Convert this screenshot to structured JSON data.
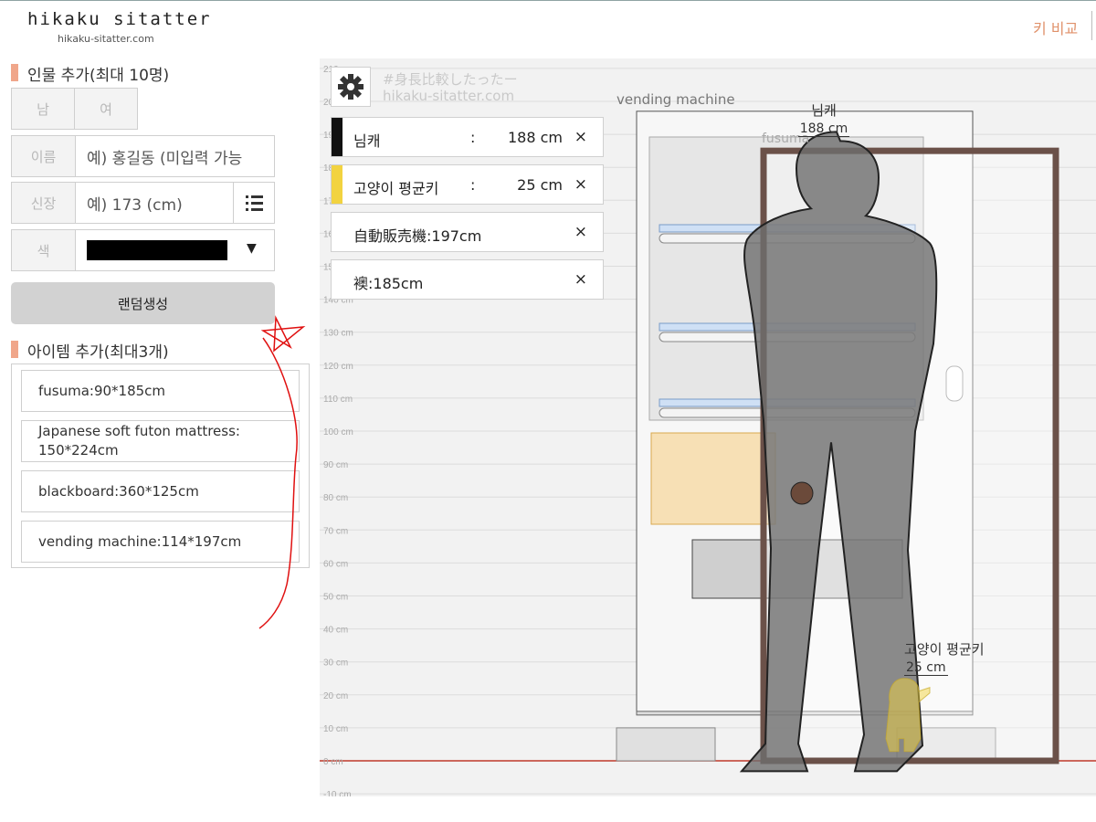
{
  "header": {
    "logo": "hikaku sitatter",
    "logo_sub": "hikaku-sitatter.com",
    "nav_compare": "키 비교"
  },
  "person_form": {
    "section_title": "인물 추가(최대 10명)",
    "gender_male": "남",
    "gender_female": "여",
    "name_label": "이름",
    "name_placeholder": "예) 홍길동 (미입력 가능",
    "height_label": "신장",
    "height_placeholder": "예) 173 (cm)",
    "color_label": "색",
    "color_value": "#000000",
    "random_button": "랜덤생성"
  },
  "items_form": {
    "section_title": "아이템 추가(최대3개)",
    "items": [
      {
        "label": "fusuma:90*185cm"
      },
      {
        "label": "Japanese soft futon mattress: 150*224cm"
      },
      {
        "label": "blackboard:360*125cm"
      },
      {
        "label": "vending machine:114*197cm"
      }
    ]
  },
  "chart": {
    "watermark_tag": "#身長比較したったー",
    "watermark_url": "hikaku-sitatter.com",
    "axis_unit": "cm",
    "axis_ticks": [
      -10,
      0,
      10,
      20,
      30,
      40,
      50,
      60,
      70,
      80,
      90,
      100,
      110,
      120,
      130,
      140,
      150,
      160,
      170,
      180,
      190,
      200,
      210
    ],
    "entries": [
      {
        "name": "님캐",
        "colon": ":",
        "value": "188 cm",
        "color": "#111111",
        "remove": "×"
      },
      {
        "name": "고양이 평균키",
        "colon": ":",
        "value": "25 cm",
        "color": "#f2d340",
        "remove": "×"
      },
      {
        "name": "自動販売機:197cm",
        "remove": "×"
      },
      {
        "name": "襖:185cm",
        "remove": "×"
      }
    ],
    "figures": {
      "person_name": "님캐",
      "person_height": "188 cm",
      "cat_name": "고양이 평균키",
      "cat_height": "25 cm",
      "vending_label": "vending machine",
      "fusuma_label": "fusuma"
    }
  }
}
